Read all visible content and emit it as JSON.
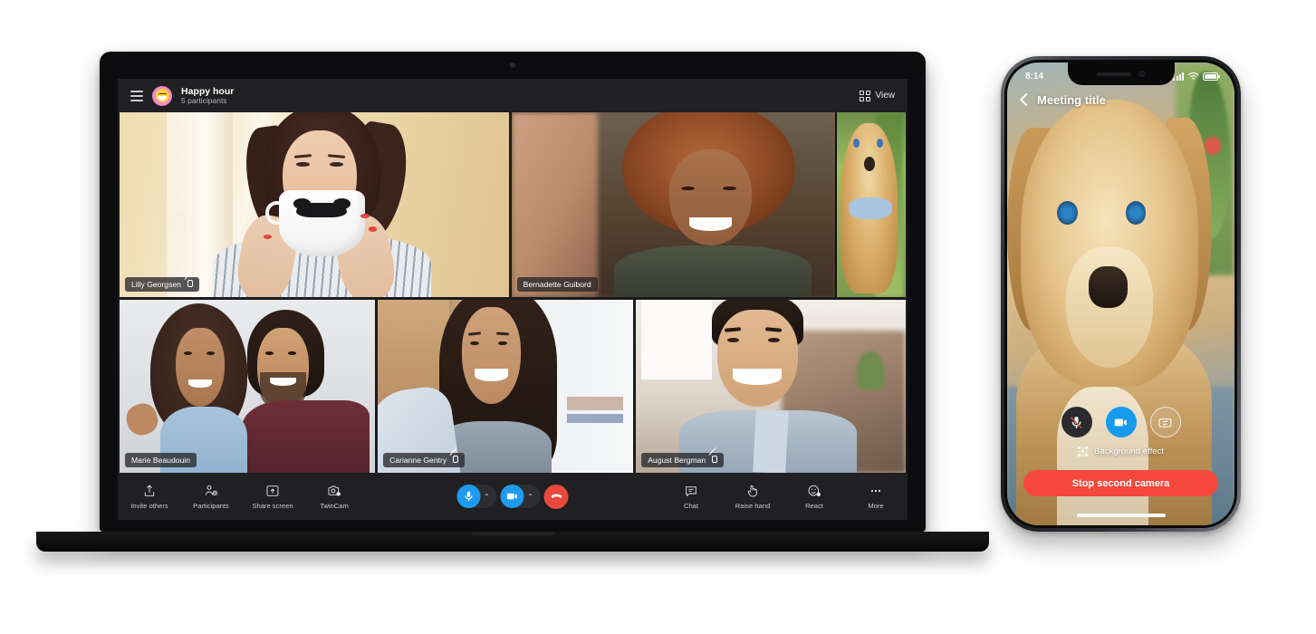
{
  "laptop": {
    "header": {
      "menu_icon": "hamburger-menu-icon",
      "avatar_icon": "group-avatar-emoji",
      "title": "Happy hour",
      "subtitle": "5 participants",
      "view_label": "View",
      "view_icon": "grid-view-icon"
    },
    "participants": [
      {
        "name": "Lilly Georgsen",
        "muted": true,
        "mic_icon": "mic-off-icon"
      },
      {
        "name": "Bernadette Guibord",
        "muted": false,
        "mic_icon": ""
      },
      {
        "name": "Marie Beaudouin",
        "muted": false,
        "mic_icon": ""
      },
      {
        "name": "Carianne Gentry",
        "muted": true,
        "mic_icon": "mic-off-icon"
      },
      {
        "name": "August Bergman",
        "muted": true,
        "mic_icon": "mic-off-icon"
      }
    ],
    "toolbar_left": [
      {
        "label": "Invite others",
        "icon": "share-upload-icon"
      },
      {
        "label": "Participants",
        "icon": "people-add-icon"
      },
      {
        "label": "Share screen",
        "icon": "screen-share-icon"
      },
      {
        "label": "TwinCam",
        "icon": "twincam-camera-icon"
      }
    ],
    "toolbar_right": [
      {
        "label": "Chat",
        "icon": "chat-bubble-icon"
      },
      {
        "label": "Raise hand",
        "icon": "raise-hand-icon"
      },
      {
        "label": "React",
        "icon": "react-emoji-icon"
      },
      {
        "label": "More",
        "icon": "more-ellipsis-icon"
      }
    ],
    "call_controls": {
      "mic_icon": "microphone-icon",
      "mic_chevron": "⌃",
      "camera_icon": "video-camera-icon",
      "camera_chevron": "⌃",
      "hangup_icon": "end-call-icon"
    },
    "colors": {
      "accent_blue": "#1e9bf0",
      "hangup_red": "#e8483d",
      "chrome": "#201f21",
      "screen_bg": "#1b1b1d"
    }
  },
  "phone": {
    "status": {
      "time": "8:14",
      "signal_icon": "cellular-signal-icon",
      "wifi_icon": "wifi-icon",
      "battery_icon": "battery-icon"
    },
    "topbar": {
      "back_icon": "back-chevron-icon",
      "title": "Meeting title"
    },
    "controls": {
      "mic_icon": "mic-off-icon",
      "mic_muted": true,
      "camera_icon": "video-camera-icon",
      "flip_icon": "camera-flip-icon",
      "background_effect_label": "Background effect",
      "background_effect_icon": "background-effect-icon",
      "stop_button_label": "Stop second camera"
    },
    "colors": {
      "accent_blue": "#169bec",
      "stop_red": "#f4483c"
    }
  }
}
